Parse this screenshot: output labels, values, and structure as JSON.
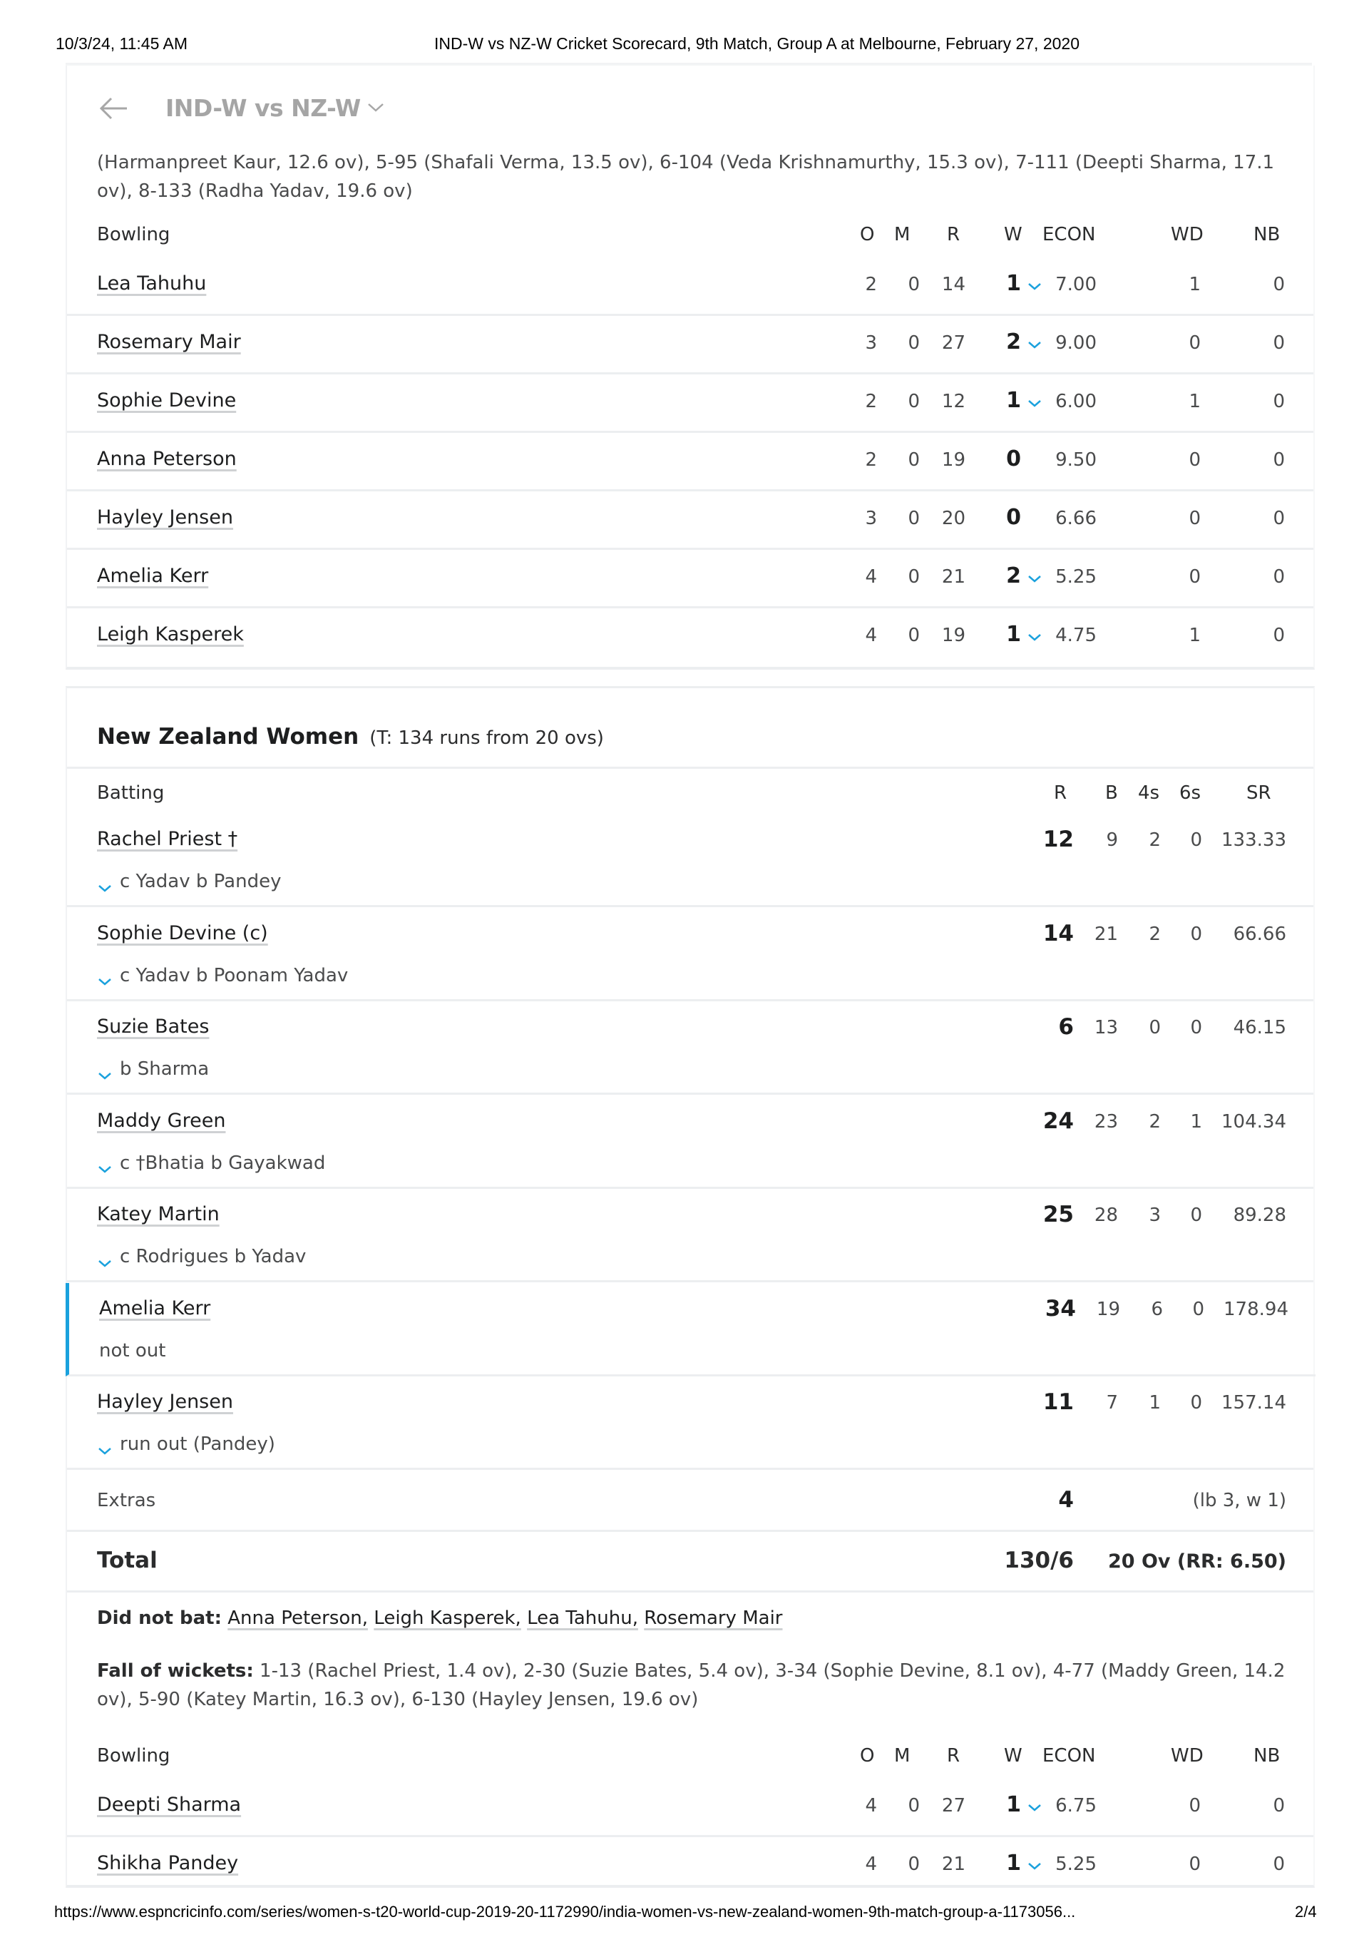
{
  "print_header": {
    "datetime": "10/3/24, 11:45 AM",
    "doc_title": "IND-W vs NZ-W Cricket Scorecard, 9th Match, Group A at Melbourne, February 27, 2020"
  },
  "print_footer": {
    "url": "https://www.espncricinfo.com/series/women-s-t20-world-cup-2019-20-1172990/india-women-vs-new-zealand-women-9th-match-group-a-1173056...",
    "page": "2/4"
  },
  "nav": {
    "back_icon": "arrow-left-icon",
    "title": "IND-W vs NZ-W",
    "dropdown_icon": "chevron-down-icon"
  },
  "india_innings": {
    "fall_of_wickets_continued": "(Harmanpreet Kaur, 12.6 ov), 5-95 (Shafali Verma, 13.5 ov), 6-104 (Veda Krishnamurthy, 15.3 ov), 7-111 (Deepti Sharma, 17.1 ov), 8-133 (Radha Yadav, 19.6 ov)",
    "bowling_headers": [
      "Bowling",
      "O",
      "M",
      "R",
      "W",
      "ECON",
      "WD",
      "NB"
    ],
    "bowling": [
      {
        "name": "Lea Tahuhu",
        "o": "2",
        "m": "0",
        "r": "14",
        "w": "1",
        "econ": "7.00",
        "wd": "1",
        "nb": "0",
        "expandable": true
      },
      {
        "name": "Rosemary Mair",
        "o": "3",
        "m": "0",
        "r": "27",
        "w": "2",
        "econ": "9.00",
        "wd": "0",
        "nb": "0",
        "expandable": true
      },
      {
        "name": "Sophie Devine",
        "o": "2",
        "m": "0",
        "r": "12",
        "w": "1",
        "econ": "6.00",
        "wd": "1",
        "nb": "0",
        "expandable": true
      },
      {
        "name": "Anna Peterson",
        "o": "2",
        "m": "0",
        "r": "19",
        "w": "0",
        "econ": "9.50",
        "wd": "0",
        "nb": "0",
        "expandable": false
      },
      {
        "name": "Hayley Jensen",
        "o": "3",
        "m": "0",
        "r": "20",
        "w": "0",
        "econ": "6.66",
        "wd": "0",
        "nb": "0",
        "expandable": false
      },
      {
        "name": "Amelia Kerr",
        "o": "4",
        "m": "0",
        "r": "21",
        "w": "2",
        "econ": "5.25",
        "wd": "0",
        "nb": "0",
        "expandable": true
      },
      {
        "name": "Leigh Kasperek",
        "o": "4",
        "m": "0",
        "r": "19",
        "w": "1",
        "econ": "4.75",
        "wd": "1",
        "nb": "0",
        "expandable": true
      }
    ]
  },
  "nz_innings": {
    "team": "New Zealand Women",
    "target": "(T: 134 runs from 20 ovs)",
    "batting_headers": [
      "Batting",
      "R",
      "B",
      "4s",
      "6s",
      "SR"
    ],
    "batting": [
      {
        "name": "Rachel Priest †",
        "dismissal": "c Yadav b Pandey",
        "r": "12",
        "b": "9",
        "fours": "2",
        "sixes": "0",
        "sr": "133.33",
        "out": true
      },
      {
        "name": "Sophie Devine (c)",
        "dismissal": "c Yadav b Poonam Yadav",
        "r": "14",
        "b": "21",
        "fours": "2",
        "sixes": "0",
        "sr": "66.66",
        "out": true
      },
      {
        "name": "Suzie Bates",
        "dismissal": "b Sharma",
        "r": "6",
        "b": "13",
        "fours": "0",
        "sixes": "0",
        "sr": "46.15",
        "out": true
      },
      {
        "name": "Maddy Green",
        "dismissal": "c †Bhatia b Gayakwad",
        "r": "24",
        "b": "23",
        "fours": "2",
        "sixes": "1",
        "sr": "104.34",
        "out": true
      },
      {
        "name": "Katey Martin",
        "dismissal": "c Rodrigues b Yadav",
        "r": "25",
        "b": "28",
        "fours": "3",
        "sixes": "0",
        "sr": "89.28",
        "out": true
      },
      {
        "name": "Amelia Kerr",
        "dismissal": "not out",
        "r": "34",
        "b": "19",
        "fours": "6",
        "sixes": "0",
        "sr": "178.94",
        "out": false
      },
      {
        "name": "Hayley Jensen",
        "dismissal": "run out (Pandey)",
        "r": "11",
        "b": "7",
        "fours": "1",
        "sixes": "0",
        "sr": "157.14",
        "out": true
      }
    ],
    "extras": {
      "label": "Extras",
      "value": "4",
      "detail": "(lb 3, w 1)"
    },
    "total": {
      "label": "Total",
      "score": "130/6",
      "detail": "20 Ov (RR: 6.50)"
    },
    "did_not_bat": {
      "label": "Did not bat:",
      "players": [
        "Anna Peterson,",
        "Leigh Kasperek,",
        "Lea Tahuhu,",
        "Rosemary Mair"
      ]
    },
    "fall_of_wickets": {
      "label": "Fall of wickets:",
      "text": "1-13 (Rachel Priest, 1.4 ov), 2-30 (Suzie Bates, 5.4 ov), 3-34 (Sophie Devine, 8.1 ov), 4-77 (Maddy Green, 14.2 ov), 5-90 (Katey Martin, 16.3 ov), 6-130 (Hayley Jensen, 19.6 ov)"
    },
    "bowling_headers": [
      "Bowling",
      "O",
      "M",
      "R",
      "W",
      "ECON",
      "WD",
      "NB"
    ],
    "bowling": [
      {
        "name": "Deepti Sharma",
        "o": "4",
        "m": "0",
        "r": "27",
        "w": "1",
        "econ": "6.75",
        "wd": "0",
        "nb": "0",
        "expandable": true
      },
      {
        "name": "Shikha Pandey",
        "o": "4",
        "m": "0",
        "r": "21",
        "w": "1",
        "econ": "5.25",
        "wd": "0",
        "nb": "0",
        "expandable": true
      }
    ]
  },
  "colors": {
    "accent": "#1aa1dd",
    "divider": "#eceef0",
    "muted_title": "#a5a5a5"
  }
}
